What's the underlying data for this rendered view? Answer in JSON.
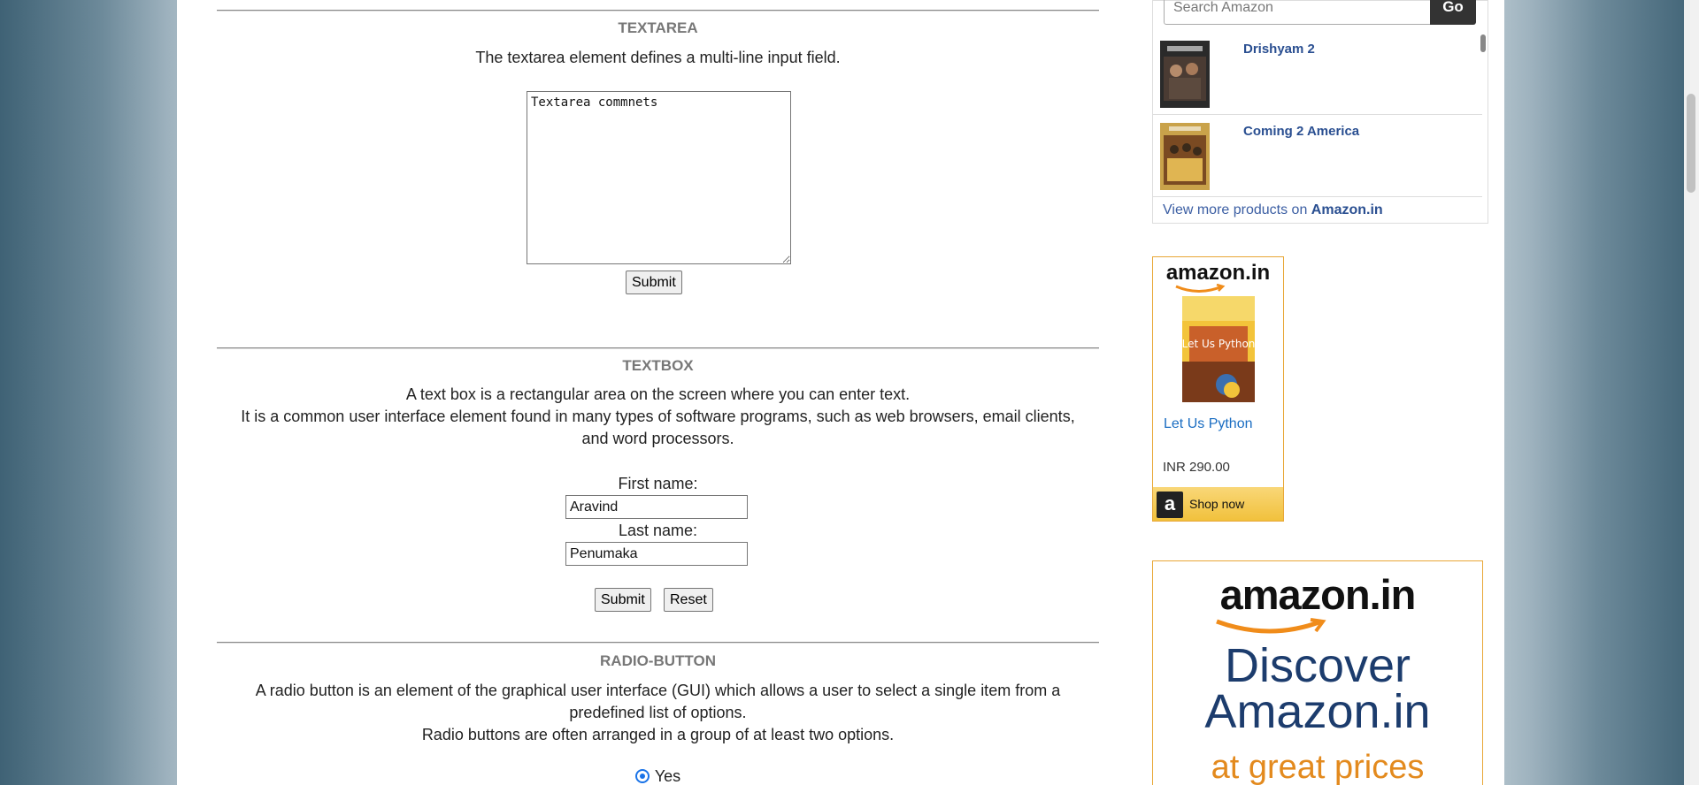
{
  "textarea_section": {
    "title": "TEXTAREA",
    "description": "The textarea element defines a multi-line input field.",
    "textarea_value": "Textarea commnets",
    "submit_label": "Submit"
  },
  "textbox_section": {
    "title": "TEXTBOX",
    "description_line1": "A text box is a rectangular area on the screen where you can enter text.",
    "description_line2": "It is a common user interface element found in many types of software programs, such as web browsers, email clients,",
    "description_line3": "and word processors.",
    "first_name_label": "First name:",
    "first_name_value": "Aravind",
    "last_name_label": "Last name:",
    "last_name_value": "Penumaka",
    "submit_label": "Submit",
    "reset_label": "Reset"
  },
  "radio_section": {
    "title": "RADIO-BUTTON",
    "description_line1": "A radio button is an element of the graphical user interface (GUI) which allows a user to select a single item from a",
    "description_line2": "predefined list of options.",
    "description_line3": "Radio buttons are often arranged in a group of at least two options.",
    "option_yes": "Yes"
  },
  "amazon_widget": {
    "search_placeholder": "Search Amazon",
    "go_label": "Go",
    "products": [
      {
        "name": "Drishyam 2"
      },
      {
        "name": "Coming 2 America"
      }
    ],
    "view_more_prefix": "View more products on ",
    "view_more_site": "Amazon.in"
  },
  "ad_small": {
    "logo": "amazon.in",
    "product": "Let Us Python",
    "price": "INR 290.00",
    "shop_label": "Shop now",
    "book_title": "Let Us Python"
  },
  "ad_big": {
    "logo": "amazon.in",
    "headline_line1": "Discover",
    "headline_line2": "Amazon.in",
    "tagline": "at great prices"
  }
}
